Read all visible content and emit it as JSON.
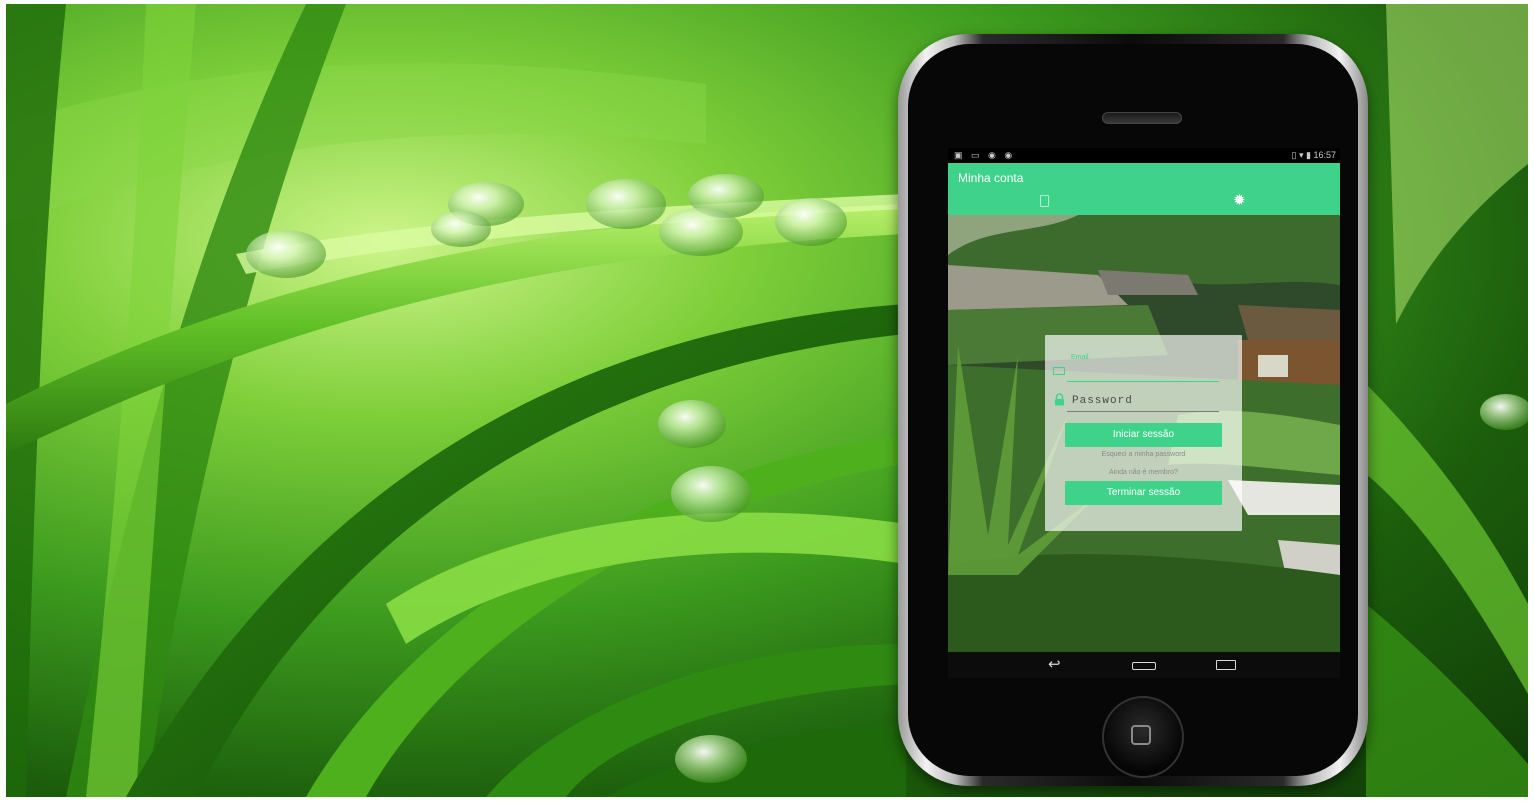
{
  "statusbar": {
    "left_icons": "▣ ▭ ◉ ◉",
    "time": "16:57",
    "right_icons": "▯ ▾ ▮"
  },
  "appbar": {
    "title": "Minha conta",
    "tabs": [
      {
        "icon": "document-icon"
      },
      {
        "icon": "gear-icon",
        "glyph": "✹"
      }
    ]
  },
  "login": {
    "email_label": "Email",
    "password_placeholder": "Password",
    "login_button": "Iniciar sessão",
    "forgot_link": "Esqueci a minha password",
    "member_link": "Ainda não é membro?",
    "logout_button": "Terminar sessão"
  },
  "navbar": {
    "back_glyph": "↩"
  },
  "colors": {
    "accent": "#3fd28a",
    "background_green": "#3c9a1e"
  }
}
